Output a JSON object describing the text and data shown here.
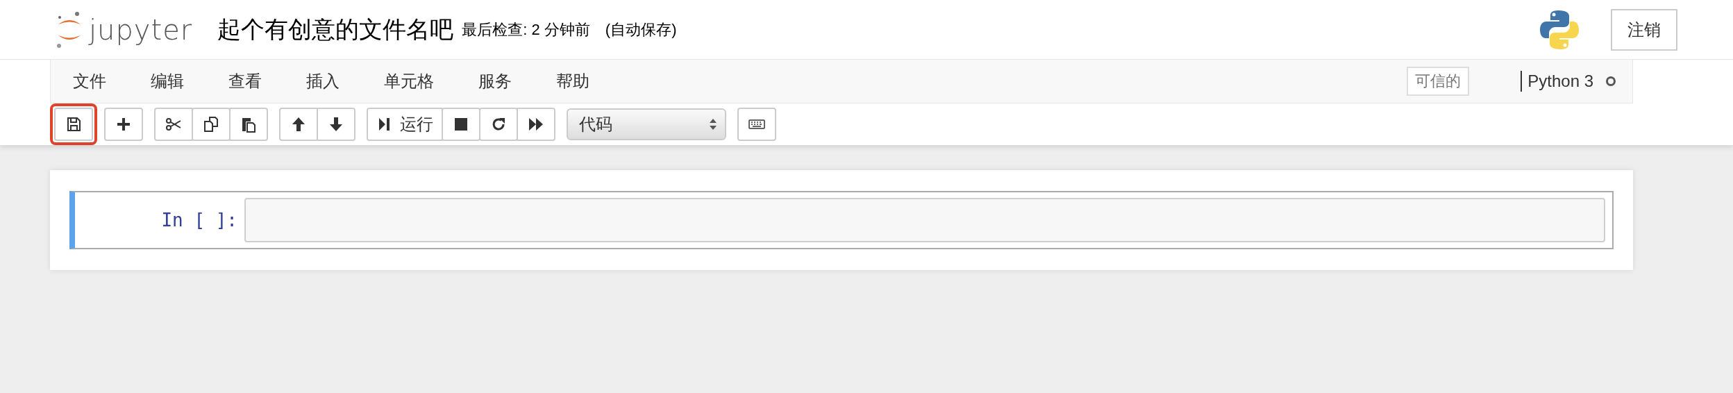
{
  "header": {
    "logo_text": "jupyter",
    "notebook_name": "起个有创意的文件名吧",
    "checkpoint": "最后检查: 2 分钟前",
    "autosave": "(自动保存)",
    "logout_button": "注销"
  },
  "menu": [
    "文件",
    "编辑",
    "查看",
    "插入",
    "单元格",
    "服务",
    "帮助"
  ],
  "trusted_label": "可信的",
  "kernel": {
    "name": "Python 3",
    "busy": false
  },
  "toolbar": [
    [
      {
        "kind": "save",
        "highlighted": true
      }
    ],
    [
      {
        "kind": "add"
      }
    ],
    [
      {
        "kind": "cut"
      },
      {
        "kind": "copy"
      },
      {
        "kind": "paste"
      }
    ],
    [
      {
        "kind": "up"
      },
      {
        "kind": "down"
      }
    ],
    [
      {
        "kind": "run",
        "label": "运行"
      },
      {
        "kind": "stop"
      },
      {
        "kind": "restart"
      },
      {
        "kind": "fastforward"
      }
    ],
    [
      {
        "kind": "select",
        "value": "代码"
      }
    ],
    [
      {
        "kind": "keyboard"
      }
    ]
  ],
  "cell": {
    "prompt": "In [ ]:",
    "selected": true
  }
}
